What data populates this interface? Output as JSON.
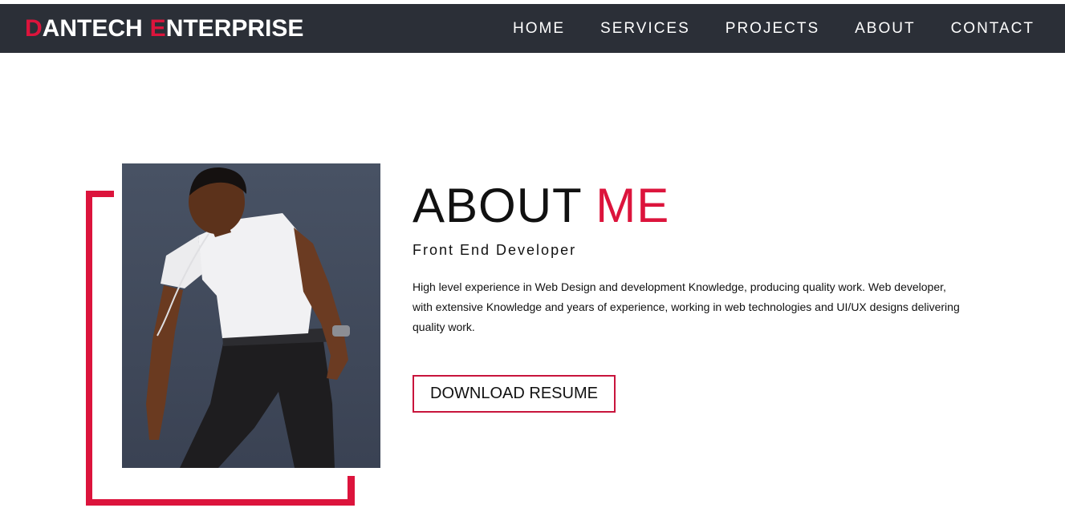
{
  "brand": {
    "first_initial": "D",
    "first_rest": "ANTECH",
    "second_initial": "E",
    "second_rest": "NTERPRISE",
    "accent_color": "#dc143c",
    "nav_background": "#2b2f37"
  },
  "nav": {
    "items": [
      {
        "label": "HOME"
      },
      {
        "label": "SERVICES"
      },
      {
        "label": "PROJECTS"
      },
      {
        "label": "ABOUT"
      },
      {
        "label": "CONTACT"
      }
    ]
  },
  "about": {
    "title_main": "ABOUT",
    "title_accent": "ME",
    "subtitle": "Front End Developer",
    "description": "High level experience in Web Design and development Knowledge, producing quality work. Web developer, with extensive Knowledge and years of experience, working in web technologies and UI/UX designs delivering quality work.",
    "resume_button": "DOWNLOAD RESUME"
  }
}
